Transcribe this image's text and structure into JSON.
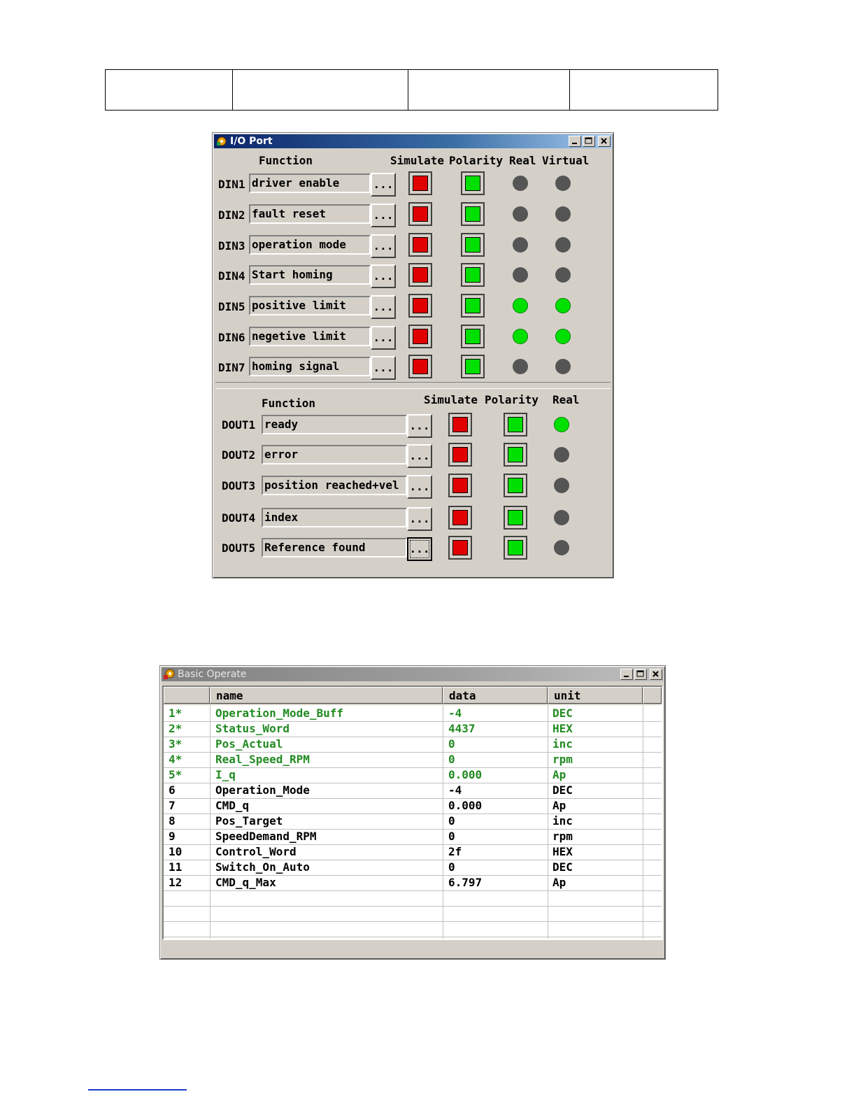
{
  "io_window": {
    "title": "I/O Port",
    "din_headers": {
      "function": "Function",
      "simulate": "Simulate",
      "polarity": "Polarity",
      "real": "Real",
      "virtual": "Virtual"
    },
    "din_rows": [
      {
        "label": "DIN1",
        "function": "driver enable",
        "button": "...",
        "simulate": "red",
        "polarity": "green",
        "real": "off",
        "virtual": "off"
      },
      {
        "label": "DIN2",
        "function": "fault reset",
        "button": "...",
        "simulate": "red",
        "polarity": "green",
        "real": "off",
        "virtual": "off"
      },
      {
        "label": "DIN3",
        "function": "operation mode",
        "button": "...",
        "simulate": "red",
        "polarity": "green",
        "real": "off",
        "virtual": "off"
      },
      {
        "label": "DIN4",
        "function": "Start homing",
        "button": "...",
        "simulate": "red",
        "polarity": "green",
        "real": "off",
        "virtual": "off"
      },
      {
        "label": "DIN5",
        "function": "positive limit",
        "button": "...",
        "simulate": "red",
        "polarity": "green",
        "real": "on",
        "virtual": "on"
      },
      {
        "label": "DIN6",
        "function": "negetive limit",
        "button": "...",
        "simulate": "red",
        "polarity": "green",
        "real": "on",
        "virtual": "on"
      },
      {
        "label": "DIN7",
        "function": "homing signal",
        "button": "...",
        "simulate": "red",
        "polarity": "green",
        "real": "off",
        "virtual": "off"
      }
    ],
    "dout_headers": {
      "function": "Function",
      "simulate": "Simulate",
      "polarity": "Polarity",
      "real": "Real"
    },
    "dout_rows": [
      {
        "label": "DOUT1",
        "function": "ready",
        "button": "...",
        "simulate": "red",
        "polarity": "green",
        "real": "on"
      },
      {
        "label": "DOUT2",
        "function": "error",
        "button": "...",
        "simulate": "red",
        "polarity": "green",
        "real": "off"
      },
      {
        "label": "DOUT3",
        "function": "position reached+vel",
        "button": "...",
        "simulate": "red",
        "polarity": "green",
        "real": "off"
      },
      {
        "label": "DOUT4",
        "function": "index",
        "button": "...",
        "simulate": "red",
        "polarity": "green",
        "real": "off"
      },
      {
        "label": "DOUT5",
        "function": "Reference found",
        "button": "...",
        "simulate": "red",
        "polarity": "green",
        "real": "off"
      }
    ]
  },
  "basic_window": {
    "title": "Basic Operate",
    "columns": [
      "",
      "name",
      "data",
      "unit"
    ],
    "rows": [
      {
        "id": "1*",
        "name": "Operation_Mode_Buff",
        "data": "-4",
        "unit": "DEC",
        "highlight": true
      },
      {
        "id": "2*",
        "name": "Status_Word",
        "data": "4437",
        "unit": "HEX",
        "highlight": true
      },
      {
        "id": "3*",
        "name": "Pos_Actual",
        "data": "0",
        "unit": "inc",
        "highlight": true
      },
      {
        "id": "4*",
        "name": "Real_Speed_RPM",
        "data": "0",
        "unit": "rpm",
        "highlight": true
      },
      {
        "id": "5*",
        "name": "I_q",
        "data": "0.000",
        "unit": "Ap",
        "highlight": true
      },
      {
        "id": "6",
        "name": "Operation_Mode",
        "data": "-4",
        "unit": "DEC",
        "highlight": false
      },
      {
        "id": "7",
        "name": "CMD_q",
        "data": "0.000",
        "unit": "Ap",
        "highlight": false
      },
      {
        "id": "8",
        "name": "Pos_Target",
        "data": "0",
        "unit": "inc",
        "highlight": false
      },
      {
        "id": "9",
        "name": "SpeedDemand_RPM",
        "data": "0",
        "unit": "rpm",
        "highlight": false
      },
      {
        "id": "10",
        "name": "Control_Word",
        "data": "2f",
        "unit": "HEX",
        "highlight": false
      },
      {
        "id": "11",
        "name": "Switch_On_Auto",
        "data": "0",
        "unit": "DEC",
        "highlight": false
      },
      {
        "id": "12",
        "name": "CMD_q_Max",
        "data": "6.797",
        "unit": "Ap",
        "highlight": false
      }
    ],
    "empty_rows": 3
  },
  "colors": {
    "highlight_text": "#228b22",
    "led_on": "#00e000",
    "led_off": "#555555",
    "sim_red": "#e00000",
    "pol_green": "#00e000"
  }
}
